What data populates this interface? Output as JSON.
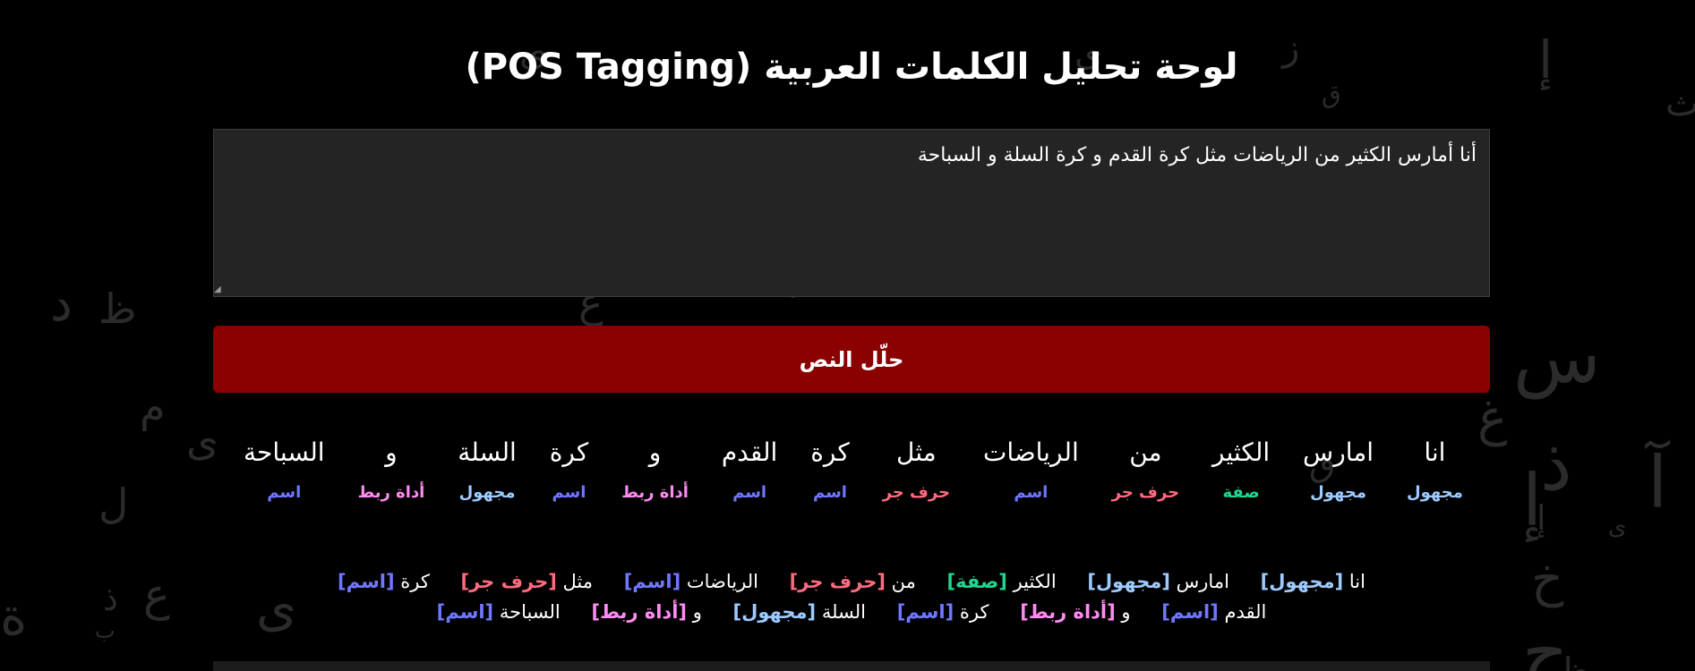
{
  "page": {
    "title": "لوحة تحليل الكلمات العربية (POS Tagging)",
    "input_value": "أنا أمارس الكثير من الرياضات مثل كرة القدم و كرة السلة و السباحة",
    "analyze_label": "حلّل النص"
  },
  "colors": {
    "background": "#000000",
    "button": "#8b0000",
    "textarea_bg": "#242424",
    "tag_unknown": "#9ecbff",
    "tag_adjective": "#1fd68e",
    "tag_preposition": "#ff6a7f",
    "tag_noun": "#6f77ff",
    "tag_conjunction": "#ff8cf2"
  },
  "tokens": [
    {
      "word": "انا",
      "tag": "مجهول",
      "type": "unknown"
    },
    {
      "word": "امارس",
      "tag": "مجهول",
      "type": "unknown"
    },
    {
      "word": "الكثير",
      "tag": "صفة",
      "type": "adjective"
    },
    {
      "word": "من",
      "tag": "حرف جر",
      "type": "preposition"
    },
    {
      "word": "الرياضات",
      "tag": "اسم",
      "type": "noun"
    },
    {
      "word": "مثل",
      "tag": "حرف جر",
      "type": "preposition"
    },
    {
      "word": "كرة",
      "tag": "اسم",
      "type": "noun"
    },
    {
      "word": "القدم",
      "tag": "اسم",
      "type": "noun"
    },
    {
      "word": "و",
      "tag": "أداة ربط",
      "type": "conjunction"
    },
    {
      "word": "كرة",
      "tag": "اسم",
      "type": "noun"
    },
    {
      "word": "السلة",
      "tag": "مجهول",
      "type": "unknown"
    },
    {
      "word": "و",
      "tag": "أداة ربط",
      "type": "conjunction"
    },
    {
      "word": "السباحة",
      "tag": "اسم",
      "type": "noun"
    }
  ],
  "background_letters": [
    "إ",
    "ز",
    "ق",
    "ث",
    "د",
    "ظ",
    "م",
    "ى",
    "س",
    "غ",
    "ذ",
    "إ",
    "آ",
    "ى",
    "إ",
    "خ",
    "ع",
    "ذ",
    "ب",
    "ة",
    "ى",
    "ج",
    "ظ",
    "ق",
    "ع",
    "ى",
    "ى",
    "ع",
    "ل",
    "ا"
  ]
}
